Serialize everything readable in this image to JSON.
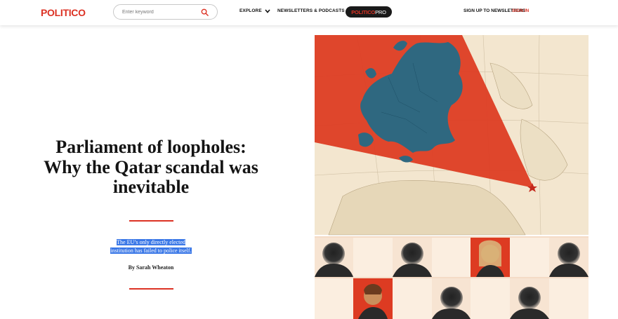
{
  "header": {
    "logo": "POLITICO",
    "search_placeholder": "Enter keyword",
    "nav": [
      {
        "label": "EXPLORE"
      },
      {
        "label": "NEWSLETTERS & PODCASTS"
      }
    ],
    "pro_label_a": "POLITICO",
    "pro_label_b": "PRO",
    "signup_label": "SIGN UP TO NEWSLETTERS",
    "signin_label": "SIGN IN"
  },
  "article": {
    "title_lines": [
      "Parliament of loopholes:",
      "Why the Qatar scandal was",
      "inevitable"
    ],
    "dek_lines": [
      "The EU’s only directly elected",
      "institution has failed to police itself."
    ],
    "byline": "By Sarah Wheaton"
  },
  "colors": {
    "brand_red": "#dc3224",
    "map_blue": "#2f6880",
    "paper": "#f3e6cf",
    "selection": "#3b78e7"
  },
  "icons": [
    "search-icon",
    "chevron-down-icon"
  ]
}
